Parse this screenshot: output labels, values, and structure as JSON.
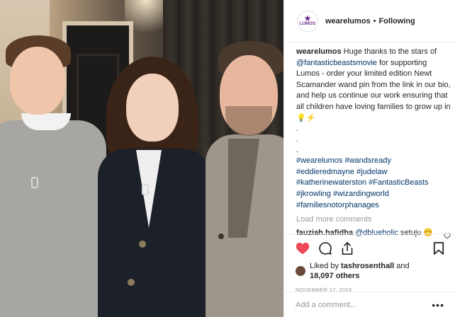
{
  "header": {
    "avatar_text": "LUMOS",
    "username": "wearelumos",
    "separator": "•",
    "follow_status": "Following"
  },
  "caption": {
    "username": "wearelumos",
    "text_1": "Huge thanks to the stars of",
    "mention": "@fantasticbeastsmovie",
    "text_2": "for supporting Lumos - order your limited edition Newt Scamander wand pin from the link in our bio, and help us continue our work ensuring that all children have loving families to grow up in",
    "emojis": "💡⚡",
    "dots": [
      ".",
      ".",
      "."
    ],
    "hashtags": [
      "#wearelumos",
      "#wandsready",
      "#eddieredmayne",
      "#judelaw",
      "#katherinewaterston",
      "#FantasticBeasts",
      "#jkrowling",
      "#wizardingworld",
      "#familiesnotorphanages"
    ]
  },
  "load_more": "Load more comments",
  "comment": {
    "username": "fauziah.hafidha",
    "mention": "@dblueholic",
    "text": "setuju",
    "emoji": "😊"
  },
  "actions": {
    "like_color": "#ed4956",
    "liked_by_prefix": "Liked by",
    "liked_by_user": "tashrosenthall",
    "and": "and",
    "others_count": "18,097 others",
    "date": "NOVEMBER 17, 2018"
  },
  "add_comment": {
    "placeholder": "Add a comment...",
    "more": "•••"
  },
  "colors": {
    "link": "#003569",
    "brand": "#6a2c91",
    "muted": "#999999"
  }
}
